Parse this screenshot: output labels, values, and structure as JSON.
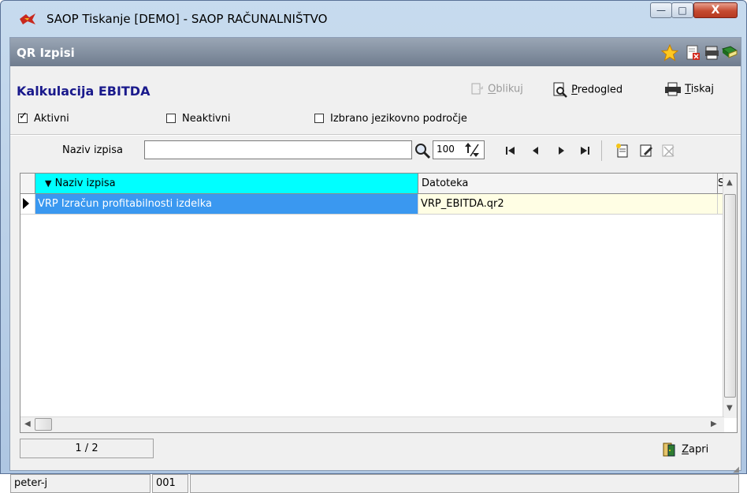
{
  "window": {
    "title": "SAOP Tiskanje [DEMO] - SAOP RAČUNALNIŠTVO",
    "controls": {
      "minimize": "—",
      "maximize": "□",
      "close": "X"
    }
  },
  "module": {
    "title": "QR Izpisi",
    "icons": [
      "star-icon",
      "delete-report-icon",
      "printers-icon",
      "book-icon"
    ]
  },
  "heading": "Kalkulacija EBITDA",
  "toolbar": {
    "oblikuj": {
      "prefix": "",
      "hotkey": "O",
      "rest": "blikuj"
    },
    "predogled": {
      "prefix": "",
      "hotkey": "P",
      "rest": "redogled"
    },
    "tiskaj": {
      "prefix": "",
      "hotkey": "T",
      "rest": "iskaj"
    }
  },
  "filters": {
    "aktivni": {
      "label": "Aktivni",
      "checked": true
    },
    "neaktivni": {
      "label": "Neaktivni",
      "checked": false
    },
    "jezik": {
      "label": "Izbrano jezikovno področje",
      "checked": false
    }
  },
  "search": {
    "label": "Naziv izpisa",
    "value": "",
    "limit": "100"
  },
  "grid": {
    "columns": [
      "Naziv izpisa",
      "Datoteka",
      "S"
    ],
    "sort_column": "Naziv izpisa",
    "rows": [
      {
        "naziv": "VRP Izračun profitabilnosti izdelka",
        "datoteka": "VRP_EBITDA.qr2",
        "selected": true
      }
    ]
  },
  "pager": "1 / 2",
  "close_button": {
    "hotkey": "Z",
    "rest": "apri"
  },
  "statusbar": {
    "user": "peter-j",
    "code": "001",
    "extra": ""
  },
  "colors": {
    "header_highlight": "#00ffff",
    "selected_row": "#3a98f0",
    "file_cell": "#fffee4",
    "heading": "#1a1a8c"
  }
}
